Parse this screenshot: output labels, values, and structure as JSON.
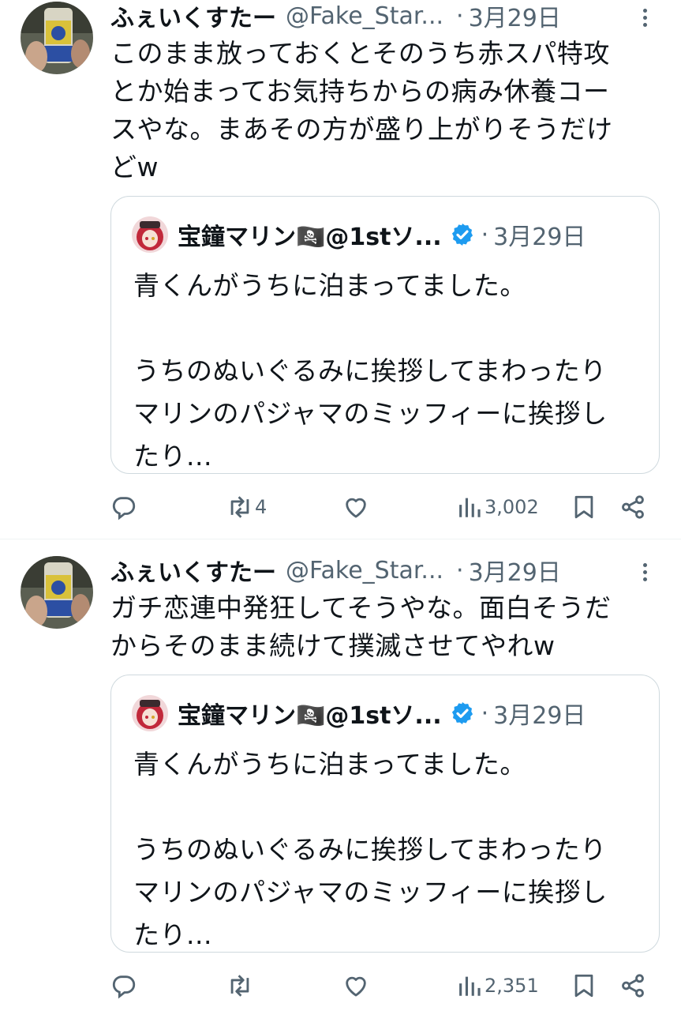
{
  "tweets": [
    {
      "author": {
        "name": "ふぇいくすたー",
        "handle": "@Fake_Star..."
      },
      "separator": "·",
      "date": "3月29日",
      "text": "このまま放っておくとそのうち赤スパ特攻\nとか始まってお気持ちからの病み休養コー\nスやな。まあその方が盛り上がりそうだけ\nどw",
      "quoted": {
        "author": {
          "name": "宝鐘マリン🏴‍☠️@1stソ..."
        },
        "separator": "·",
        "date": "3月29日",
        "text": "青くんがうちに泊まってました。\n\nうちのぬいぐるみに挨拶してまわったり\nマリンのパジャマのミッフィーに挨拶し\nたり..."
      },
      "actions": {
        "reply": "",
        "retweet": "4",
        "like": "",
        "views": "3,002"
      }
    },
    {
      "author": {
        "name": "ふぇいくすたー",
        "handle": "@Fake_Star..."
      },
      "separator": "·",
      "date": "3月29日",
      "text": "ガチ恋連中発狂してそうやな。面白そうだ\nからそのまま続けて撲滅させてやれw",
      "quoted": {
        "author": {
          "name": "宝鐘マリン🏴‍☠️@1stソ..."
        },
        "separator": "·",
        "date": "3月29日",
        "text": "青くんがうちに泊まってました。\n\nうちのぬいぐるみに挨拶してまわったり\nマリンのパジャマのミッフィーに挨拶し\nたり..."
      },
      "actions": {
        "reply": "",
        "retweet": "",
        "like": "",
        "views": "2,351"
      }
    }
  ],
  "colors": {
    "text": "#0f1419",
    "secondary": "#536471",
    "border": "#cfd9de",
    "verified": "#1d9bf0"
  },
  "icons": [
    "reply-icon",
    "retweet-icon",
    "like-icon",
    "views-icon",
    "bookmark-icon",
    "share-icon",
    "more-icon",
    "verified-badge-icon"
  ]
}
